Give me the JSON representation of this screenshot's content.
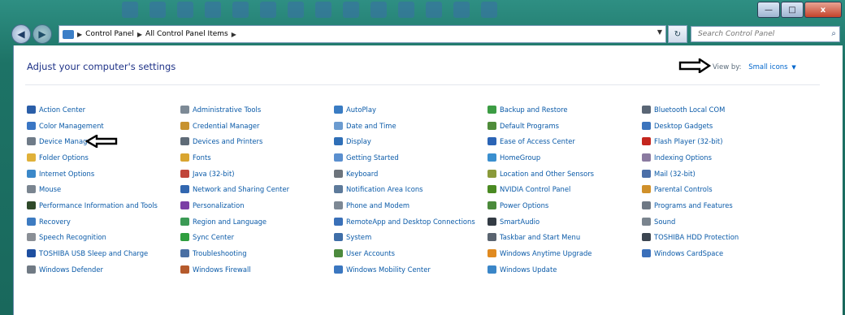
{
  "window": {
    "minimize_glyph": "—",
    "maximize_glyph": "□",
    "close_glyph": "x"
  },
  "address_bar": {
    "crumbs": [
      "Control Panel",
      "All Control Panel Items"
    ],
    "search_placeholder": "Search Control Panel"
  },
  "content": {
    "heading": "Adjust your computer's settings",
    "view_by_label": "View by:",
    "view_by_value": "Small icons"
  },
  "columns": [
    [
      {
        "label": "Action Center",
        "icon": "flag-icon",
        "color": "#2a5ea8"
      },
      {
        "label": "Color Management",
        "icon": "monitor-icon",
        "color": "#3a76c4"
      },
      {
        "label": "Device Manager",
        "icon": "printer-icon",
        "color": "#6f7b88"
      },
      {
        "label": "Folder Options",
        "icon": "folder-icon",
        "color": "#e0b13a"
      },
      {
        "label": "Internet Options",
        "icon": "globe-icon",
        "color": "#3b88c9"
      },
      {
        "label": "Mouse",
        "icon": "mouse-icon",
        "color": "#7a8590"
      },
      {
        "label": "Performance Information and Tools",
        "icon": "meter-icon",
        "color": "#2f4a2a"
      },
      {
        "label": "Recovery",
        "icon": "recovery-icon",
        "color": "#3d7bc1"
      },
      {
        "label": "Speech Recognition",
        "icon": "microphone-icon",
        "color": "#8a8f96"
      },
      {
        "label": "TOSHIBA USB Sleep and Charge",
        "icon": "usb-icon",
        "color": "#1e4fa0"
      },
      {
        "label": "Windows Defender",
        "icon": "castle-icon",
        "color": "#707a84"
      }
    ],
    [
      {
        "label": "Administrative Tools",
        "icon": "tools-icon",
        "color": "#7d8a96"
      },
      {
        "label": "Credential Manager",
        "icon": "vault-icon",
        "color": "#c7922e"
      },
      {
        "label": "Devices and Printers",
        "icon": "devices-icon",
        "color": "#5f6b77"
      },
      {
        "label": "Fonts",
        "icon": "fonts-icon",
        "color": "#d9a530"
      },
      {
        "label": "Java (32-bit)",
        "icon": "java-icon",
        "color": "#c0453a"
      },
      {
        "label": "Network and Sharing Center",
        "icon": "network-icon",
        "color": "#3267b0"
      },
      {
        "label": "Personalization",
        "icon": "palette-icon",
        "color": "#7b3fa5"
      },
      {
        "label": "Region and Language",
        "icon": "region-icon",
        "color": "#3b9a55"
      },
      {
        "label": "Sync Center",
        "icon": "sync-icon",
        "color": "#2f9e3e"
      },
      {
        "label": "Troubleshooting",
        "icon": "troubleshoot-icon",
        "color": "#4a6fa3"
      },
      {
        "label": "Windows Firewall",
        "icon": "firewall-icon",
        "color": "#b55a2c"
      }
    ],
    [
      {
        "label": "AutoPlay",
        "icon": "autoplay-icon",
        "color": "#3a7cc3"
      },
      {
        "label": "Date and Time",
        "icon": "clock-icon",
        "color": "#6b9bd0"
      },
      {
        "label": "Display",
        "icon": "display-icon",
        "color": "#2f6fb7"
      },
      {
        "label": "Getting Started",
        "icon": "getting-started-icon",
        "color": "#5a8fcf"
      },
      {
        "label": "Keyboard",
        "icon": "keyboard-icon",
        "color": "#6d747c"
      },
      {
        "label": "Notification Area Icons",
        "icon": "notification-icon",
        "color": "#5d7a9a"
      },
      {
        "label": "Phone and Modem",
        "icon": "phone-icon",
        "color": "#7d8894"
      },
      {
        "label": "RemoteApp and Desktop Connections",
        "icon": "remote-icon",
        "color": "#3a70b8"
      },
      {
        "label": "System",
        "icon": "system-icon",
        "color": "#3f6ea8"
      },
      {
        "label": "User Accounts",
        "icon": "users-icon",
        "color": "#4c8a3d"
      },
      {
        "label": "Windows Mobility Center",
        "icon": "mobility-icon",
        "color": "#3b77c0"
      }
    ],
    [
      {
        "label": "Backup and Restore",
        "icon": "backup-icon",
        "color": "#3c9c43"
      },
      {
        "label": "Default Programs",
        "icon": "default-programs-icon",
        "color": "#4f8c3a"
      },
      {
        "label": "Ease of Access Center",
        "icon": "ease-icon",
        "color": "#2b64b5"
      },
      {
        "label": "HomeGroup",
        "icon": "homegroup-icon",
        "color": "#3a8fcf"
      },
      {
        "label": "Location and Other Sensors",
        "icon": "sensor-icon",
        "color": "#8a9a3a"
      },
      {
        "label": "NVIDIA Control Panel",
        "icon": "nvidia-icon",
        "color": "#4a8a22"
      },
      {
        "label": "Power Options",
        "icon": "power-icon",
        "color": "#4b8a3b"
      },
      {
        "label": "SmartAudio",
        "icon": "audio-icon",
        "color": "#333b44"
      },
      {
        "label": "Taskbar and Start Menu",
        "icon": "taskbar-icon",
        "color": "#5a6470"
      },
      {
        "label": "Windows Anytime Upgrade",
        "icon": "upgrade-icon",
        "color": "#e08a20"
      },
      {
        "label": "Windows Update",
        "icon": "update-icon",
        "color": "#3a86c8"
      }
    ],
    [
      {
        "label": "Bluetooth Local COM",
        "icon": "bluetooth-icon",
        "color": "#5a6675"
      },
      {
        "label": "Desktop Gadgets",
        "icon": "gadgets-icon",
        "color": "#3b74bd"
      },
      {
        "label": "Flash Player (32-bit)",
        "icon": "flash-icon",
        "color": "#c4261e"
      },
      {
        "label": "Indexing Options",
        "icon": "indexing-icon",
        "color": "#8a7aa0"
      },
      {
        "label": "Mail (32-bit)",
        "icon": "mail-icon",
        "color": "#4b6fa8"
      },
      {
        "label": "Parental Controls",
        "icon": "parental-icon",
        "color": "#d0902a"
      },
      {
        "label": "Programs and Features",
        "icon": "programs-icon",
        "color": "#6e7884"
      },
      {
        "label": "Sound",
        "icon": "speaker-icon",
        "color": "#7a848e"
      },
      {
        "label": "TOSHIBA HDD Protection",
        "icon": "hdd-protection-icon",
        "color": "#3c4550"
      },
      {
        "label": "Windows CardSpace",
        "icon": "cardspace-icon",
        "color": "#3a6fba"
      }
    ]
  ]
}
